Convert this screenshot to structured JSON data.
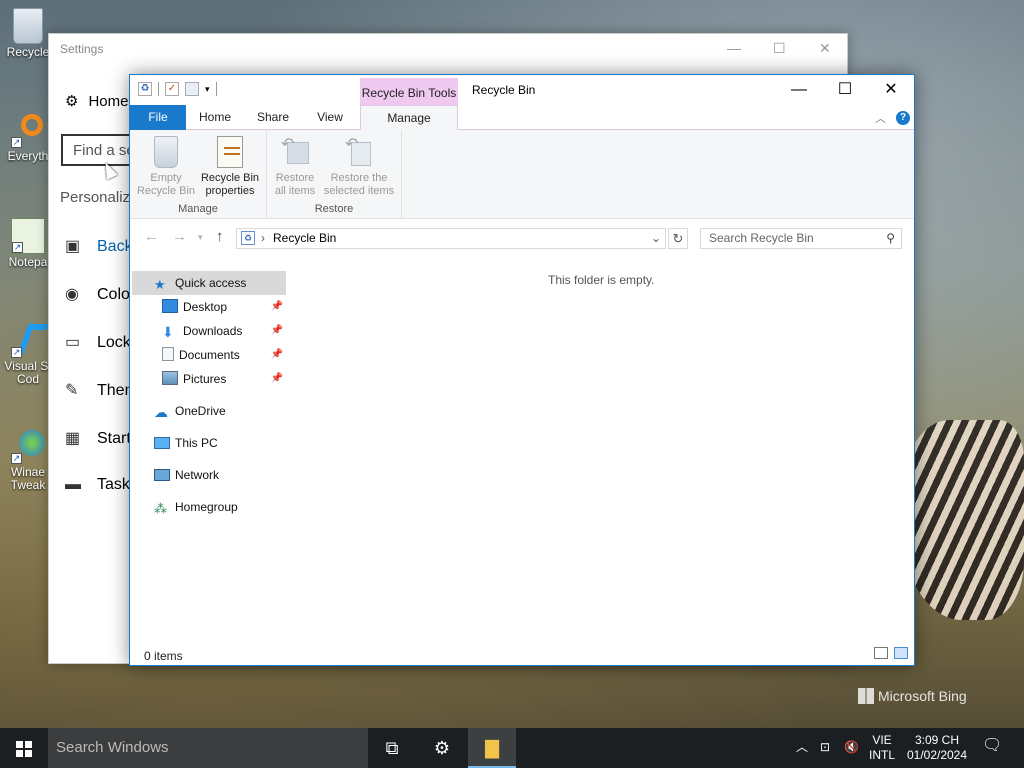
{
  "desktop": {
    "icons": [
      {
        "label": "Recycle",
        "icon": "recycle-bin-icon"
      },
      {
        "label": "Everyth",
        "icon": "everything-search-icon"
      },
      {
        "label": "Notepa",
        "icon": "notepad-icon"
      },
      {
        "label": "Visual St Cod",
        "icon": "vscode-icon"
      },
      {
        "label": "Winae Tweak",
        "icon": "winaero-icon"
      }
    ],
    "watermark": "Microsoft Bing"
  },
  "settings": {
    "title": "Settings",
    "home": "Home",
    "find_placeholder": "Find a se",
    "section": "Personaliza",
    "nav": [
      "Backg",
      "Color",
      "Lock",
      "Them",
      "Start",
      "Taskb"
    ]
  },
  "explorer": {
    "title": "Recycle Bin",
    "contextual_tab": "Recycle Bin Tools",
    "tabs": {
      "file": "File",
      "home": "Home",
      "share": "Share",
      "view": "View",
      "manage": "Manage"
    },
    "ribbon": {
      "manage_group": "Manage",
      "restore_group": "Restore",
      "empty_recycle_bin": "Empty Recycle Bin",
      "recycle_bin_properties": "Recycle Bin properties",
      "restore_all": "Restore all items",
      "restore_selected": "Restore the selected items"
    },
    "address": "Recycle Bin",
    "search_placeholder": "Search Recycle Bin",
    "nav_pane": {
      "quick_access": "Quick access",
      "desktop": "Desktop",
      "downloads": "Downloads",
      "documents": "Documents",
      "pictures": "Pictures",
      "onedrive": "OneDrive",
      "this_pc": "This PC",
      "network": "Network",
      "homegroup": "Homegroup"
    },
    "empty_message": "This folder is empty.",
    "status": "0 items"
  },
  "taskbar": {
    "search": "Search Windows",
    "language": [
      "VIE",
      "INTL"
    ],
    "time": "3:09 CH",
    "date": "01/02/2024"
  },
  "colors": {
    "accent": "#1979ca",
    "contextual": "#f0c9f0",
    "taskbar": "#1c1f22"
  }
}
